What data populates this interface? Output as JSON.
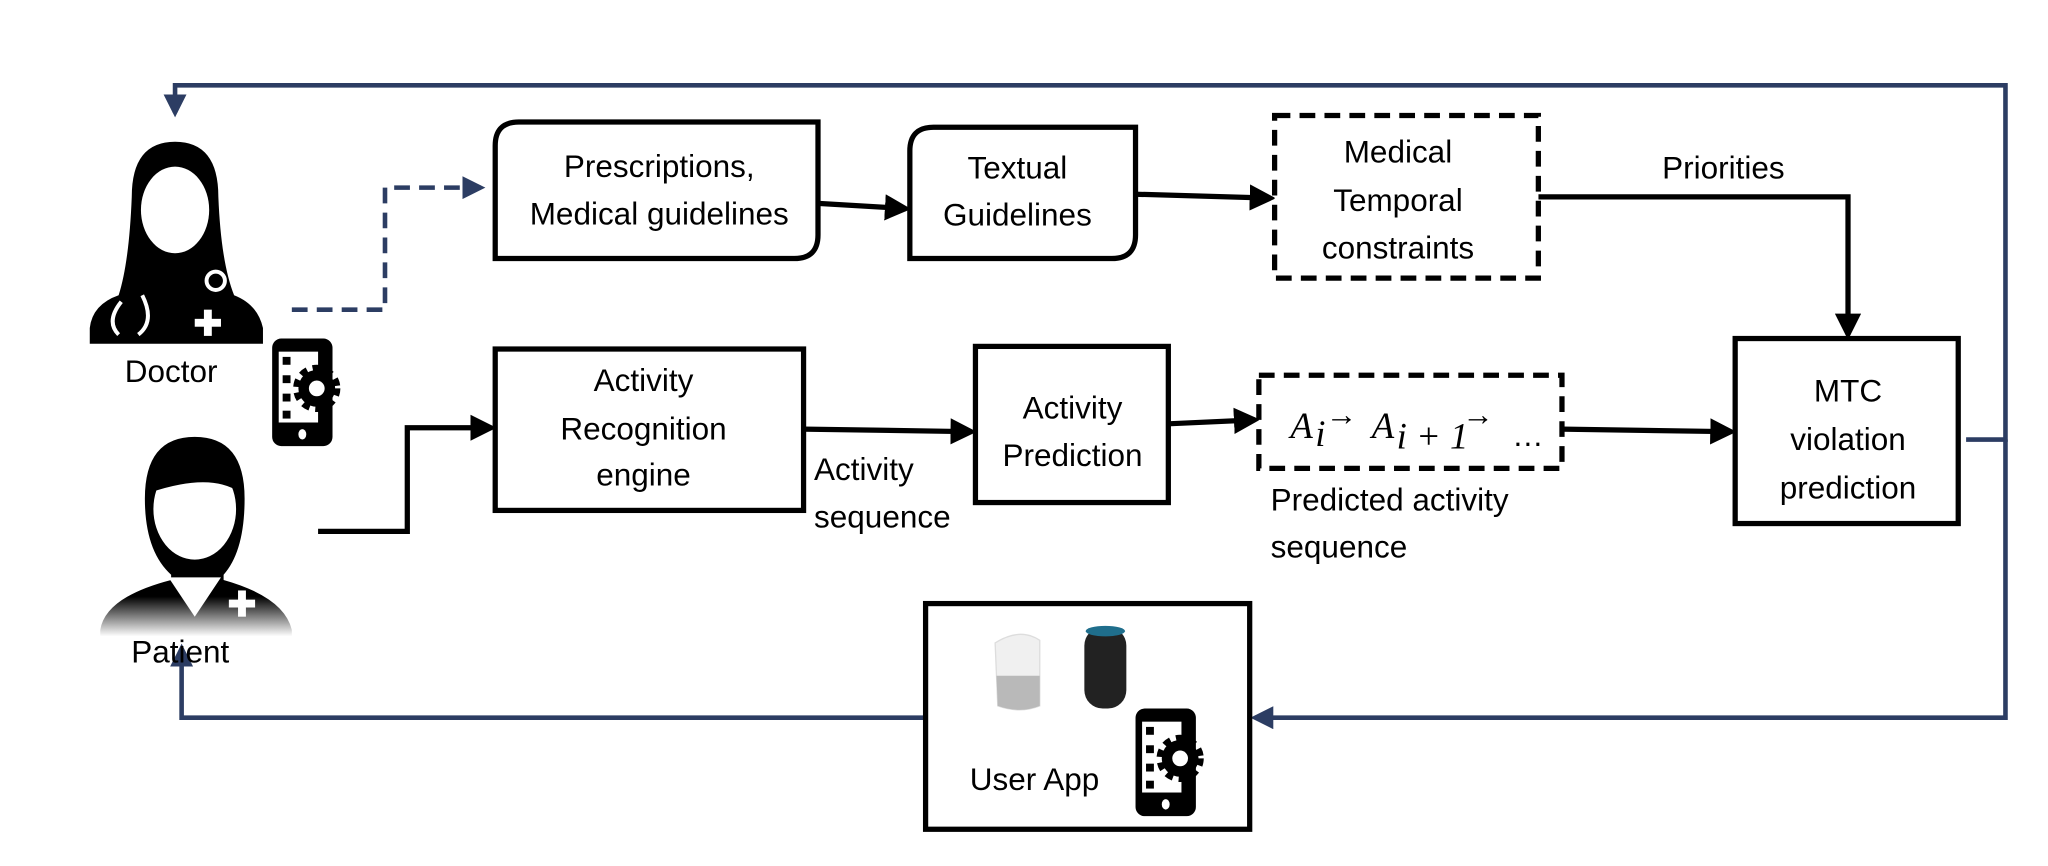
{
  "colors": {
    "feedback": "#2c3d63",
    "box": "#000000"
  },
  "actors": {
    "doctor": "Doctor",
    "patient": "Patient"
  },
  "boxes": {
    "prescriptions": [
      "Prescriptions,",
      "Medical guidelines"
    ],
    "textual": [
      "Textual",
      "Guidelines"
    ],
    "mtc_constraints": [
      "Medical",
      "Temporal",
      "constraints"
    ],
    "recognition": [
      "Activity",
      "Recognition",
      "engine"
    ],
    "prediction": [
      "Activity",
      "Prediction"
    ],
    "violation": [
      "MTC",
      "violation",
      "prediction"
    ],
    "user_app": "User App"
  },
  "labels": {
    "priorities": "Priorities",
    "activity_sequence": [
      "Activity",
      "sequence"
    ],
    "predicted_sequence": [
      "Predicted activity",
      "sequence"
    ]
  },
  "sequence": {
    "a1": "A",
    "s1": "i",
    "a2": "A",
    "s2": "i + 1",
    "ellipsis": "…"
  },
  "icons": [
    "doctor-icon",
    "patient-icon",
    "phone-gear-icon",
    "smart-speaker-icon"
  ]
}
